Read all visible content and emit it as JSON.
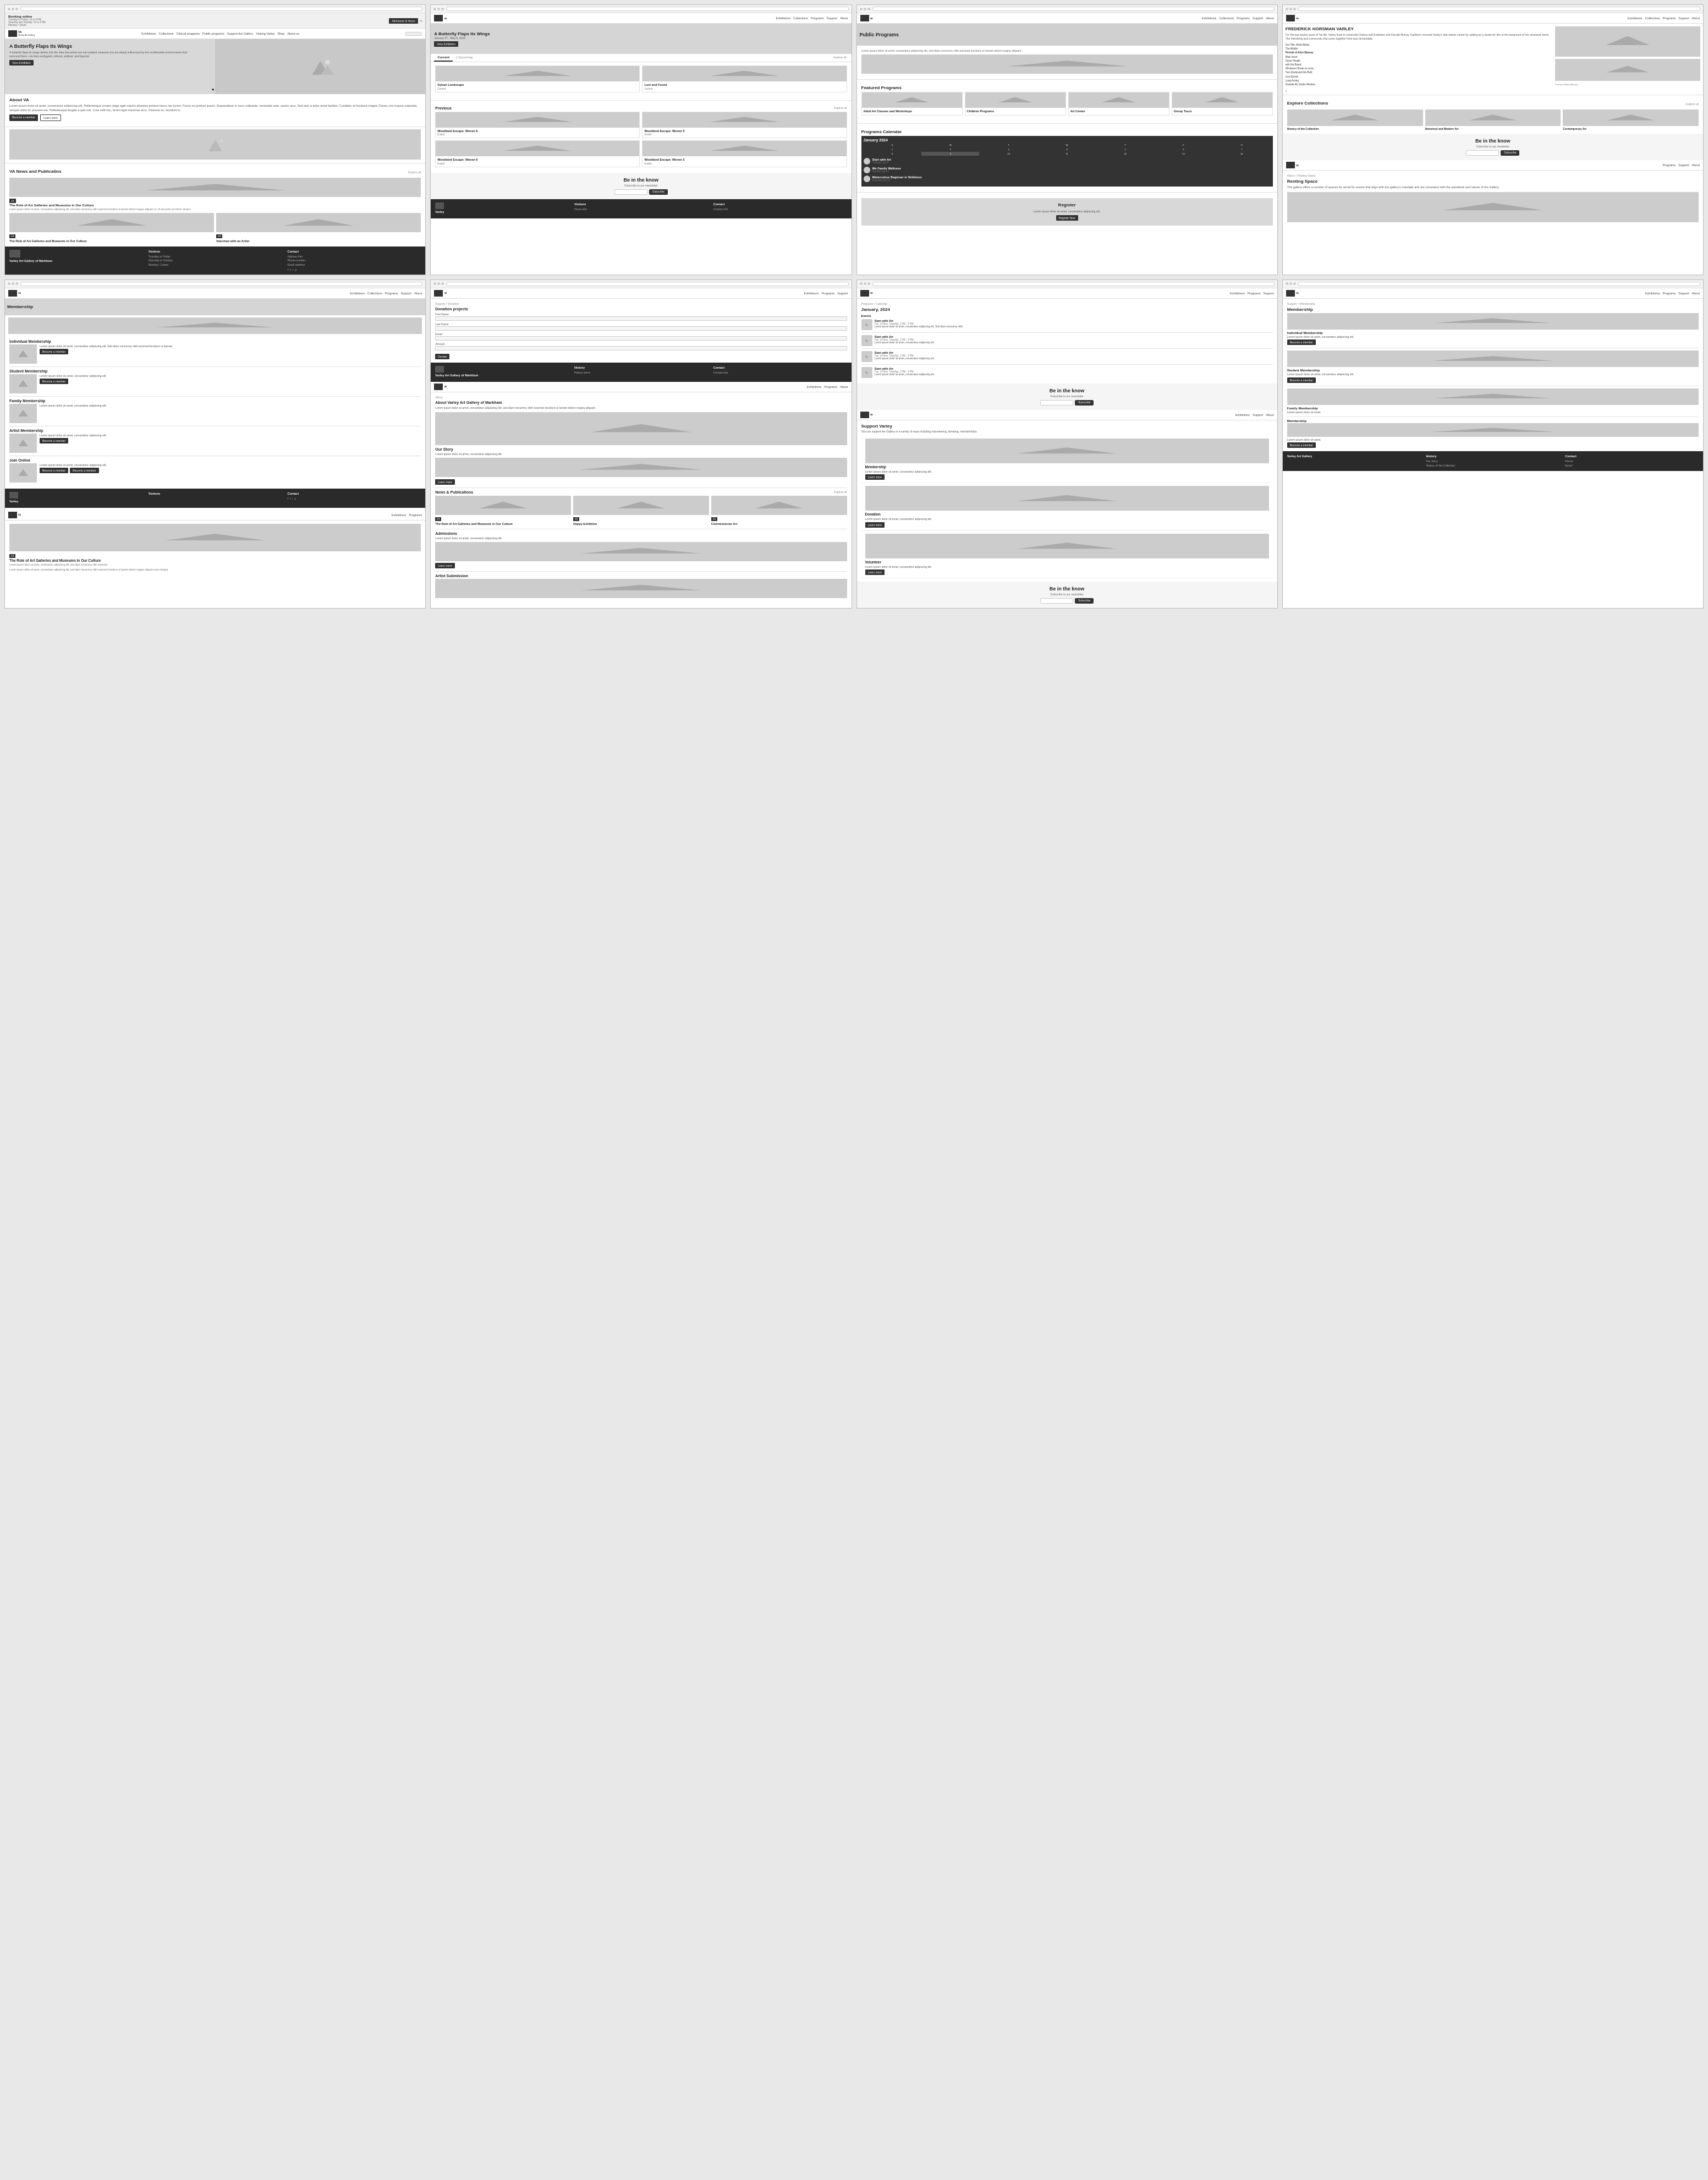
{
  "pages": {
    "homepage": {
      "title": "Varley Art Gallery",
      "nav": {
        "logo": "VA",
        "logo_sub": "Varley Art Gallery of Markham",
        "items": [
          "Exhibitions",
          "Collections",
          "Clinical programs",
          "Public programs",
          "Support the Gallery",
          "Visiting Varley",
          "Shop",
          "About us"
        ],
        "search_placeholder": "Search"
      },
      "booking": {
        "title": "Booking online",
        "hours": "Tuesday to Friday: 12 to 4 PM\nSaturday and Sunday: 12 to 4 PM\nMonday: Closed",
        "btn": "Admission & Hours",
        "close": "Close ×"
      },
      "hero": {
        "title": "A Butterfly Flaps Its Wings",
        "subtitle": "A butterfly flaps its wings delves into the idea that artists are not isolated creatures but are deeply influenced by the multifaceted environments that surround them—be they ecological, cultural, political, and beyond.",
        "btn": "View Exhibition",
        "dots": [
          "●",
          "○"
        ]
      },
      "about": {
        "title": "About VA",
        "text": "Lorem ipsum dolor sit amet, consectetur adipiscing elit. Pellentesque ornare niage eget mauris pharetra pretium lacus nec lorem. Fusce eu pretium ipsum. Suspendisse in nunc vulputate, venenatis ante, auctor arcu. Sed sed ut dolor amet facilisis. Curabitur at tincidunt magna. Donec non mauris vulputate, semper dolor id, posuere est. Pellentesque feugiat a quis nisi. Cras velit nec, lorem eget maximus arcu. Vivamus ac, tincidunt in.",
        "btn1": "Become a member",
        "btn2": "Learn more"
      },
      "news": {
        "title": "VA News and Publicatins",
        "link": "Explore all",
        "items": [
          {
            "date": "14",
            "title": "The Role of Art Galleries and Museums in Our Culture",
            "text": "Lorem ipsum dolor sit amet, consectetur adipiscing elit, sed diam nonummy nibh euismod tincidunt ut laoreet dolore magna aliquam ut. Ut wisi enim ad minim veniam.",
            "img": true
          },
          {
            "date": "14",
            "title": "The Role of Art Galleries and Museums in Our Culture",
            "img": true
          },
          {
            "date": "14",
            "title": "Interview with an Artist",
            "img": true
          }
        ]
      },
      "footer": {
        "cols": [
          {
            "title": "Varley Art Gallery of Markham",
            "items": []
          },
          {
            "title": "Visitons",
            "items": [
              "Tuesday to Friday",
              "Saturday to Sunday",
              "Monday: Closed"
            ]
          },
          {
            "title": "Contact",
            "items": [
              "Address",
              "Phone",
              "Email"
            ]
          }
        ],
        "social": [
          "f",
          "t",
          "i",
          "y"
        ]
      }
    },
    "exhibitions_page": {
      "title": "A Butterfly Flaps Its Wings",
      "date": "January 27 - May 6, 2024",
      "tabs": [
        "Current",
        "Upcoming"
      ],
      "all_link": "Explore all",
      "sections": {
        "current": [
          {
            "title": "Sylvan Landscape",
            "status": "Current",
            "img": true
          },
          {
            "title": "Lost and Found",
            "status": "Current",
            "img": true
          }
        ],
        "previous_title": "Previous",
        "previous_link": "Explore all",
        "previous": [
          {
            "title": "Woodland Escape: Woven 6",
            "status": "Ended",
            "img": true
          },
          {
            "title": "Woodland Escape: Woven 5",
            "status": "Ended",
            "img": true
          },
          {
            "title": "Woodland Escape: Woven 6",
            "status": "Ended",
            "img": true
          },
          {
            "title": "Woodland Escape: Woven 5",
            "status": "Ended",
            "img": true
          }
        ]
      }
    },
    "programs_page": {
      "title": "Public Programs",
      "featured_title": "Featured Programs",
      "featured_items": [
        {
          "title": "Adult Art Classes and Workshops",
          "img": true
        },
        {
          "title": "Children Programs",
          "img": true
        },
        {
          "title": "Art Center",
          "img": true
        },
        {
          "title": "Group Tours",
          "img": true
        }
      ],
      "calendar_title": "Programs Calendar",
      "calendar_month": "January 2024",
      "calendar_events": [
        {
          "title": "Start with Art",
          "time": "Tuesday Jan 9"
        },
        {
          "title": "We Family Wellness",
          "time": "Sunday Jan 14"
        },
        {
          "title": "Watercolour Beginner in Shildrens",
          "time": "Saturday Jan 27"
        }
      ],
      "register_title": "Register",
      "register_text": "Lorem ipsum dolor sit amet, consectetur adipiscing elit."
    },
    "membership_page": {
      "title": "Membership",
      "hero_img": true,
      "items": [
        {
          "title": "Individual Membership",
          "text": "Lorem ipsum dolor sit amet",
          "btn": "Become a member",
          "img": true
        },
        {
          "title": "Student Membership",
          "text": "Lorem ipsum dolor sit amet",
          "btn": "Become a member",
          "img": true
        },
        {
          "title": "Family Membership",
          "text": "Lorem ipsum dolor sit amet",
          "img": true
        },
        {
          "title": "Artist Membership",
          "text": "Lorem ipsum dolor sit amet",
          "btn": "Become a member",
          "img": true
        },
        {
          "title": "Join Online",
          "text": "Lorem ipsum dolor sit amet",
          "btn1": "Become a member",
          "btn2": "Become a member",
          "img": true
        }
      ]
    },
    "donation_page": {
      "title": "Donation projects",
      "form_fields": [
        "First Name",
        "Last Name",
        "Email",
        "Amount"
      ],
      "btn": "Donate",
      "footer_sections": [
        "History",
        "Contact"
      ]
    },
    "about_page": {
      "title": "About Varley Art Gallery of Markham",
      "sections": [
        {
          "title": "Our Story",
          "img": true
        },
        {
          "title": "News & Publications",
          "link": "Explore all",
          "items": [
            {
              "date": "14",
              "title": "The Role of Art Galleries and Museums in Our Culture",
              "img": true
            },
            {
              "date": "14",
              "title": "Happy Exhibtion",
              "img": true
            },
            {
              "date": "14",
              "title": "Commissioner Art",
              "img": true
            }
          ]
        },
        {
          "title": "Admissions",
          "img": true
        },
        {
          "title": "Artist Submission",
          "img": true
        }
      ]
    },
    "calendar_page": {
      "title": "January, 2024",
      "events": [
        {
          "title": "Start with Art",
          "time": "Tue, 10-Nov, Tuesday, 1 PM - 3 PM",
          "img": true
        },
        {
          "title": "Start with Art",
          "time": "Tue, 10-Nov, Tuesday, 1 PM - 3 PM",
          "img": true
        },
        {
          "title": "Start with Art",
          "time": "Tue, 10-Nov, Tuesday, 1 PM - 3 PM",
          "img": true
        },
        {
          "title": "Start with Art",
          "time": "Tue, 10-Nov, Tuesday, 1 PM - 4 PM",
          "img": true
        }
      ]
    },
    "support_page": {
      "title": "Support Varley",
      "text": "You can support the Gallery in a variety of ways including volunteering, donating, memberships.",
      "sections": [
        {
          "title": "Membership",
          "btn": "Learn more",
          "img": true
        },
        {
          "title": "Donation",
          "btn": "Learn more",
          "img": true
        },
        {
          "title": "Volunteer",
          "btn": "Learn more",
          "img": true
        }
      ]
    },
    "artist_page": {
      "title": "FREDERICK HORSMAN VARLEY",
      "text": "For the last twelve years of his life, Varley lived in Unionville Ontario with Kathleen and Donald McKay. Kathleen nurtured Varley's late artistic career by setting up a studio for him in the basement of her ancestral home. The friendship and community that came together here was remarkable.",
      "sidebar": {
        "portrait_img": true,
        "links": [
          "Our Title, Write Below",
          "The Middle",
          "Portrait of Alice Massey",
          "Main Issue",
          "Some People",
          "with the Board",
          "Whodever Break on Lime...",
          "Two (Endorsed this Bull)",
          "Live Stories",
          "Long-Acting",
          "Outside My Studio Window"
        ]
      },
      "collections_title": "Explore Collections",
      "collections": [
        {
          "title": "History of the Collection",
          "img": true
        },
        {
          "title": "Historical and Modern Art",
          "img": true
        },
        {
          "title": "Contemporary Art",
          "img": true
        }
      ]
    },
    "renting_page": {
      "title": "Renting Space",
      "text": "The gallery offers a number of spaces for rental for events that align with the gallery's mandate and are consistent with the standards and values of the Gallery.",
      "img": true
    },
    "blog_page": {
      "title": "The Role of Art Galleries and Museums in Our Culture",
      "date_label": "14",
      "img": true,
      "text": "Lorem ipsum dolor sit amet consectetur"
    }
  },
  "common": {
    "be_in_know": {
      "title": "Be in the know",
      "subtitle": "Subscribe to our newsletter",
      "btn": "Subscribe",
      "placeholder": "Your email"
    }
  }
}
